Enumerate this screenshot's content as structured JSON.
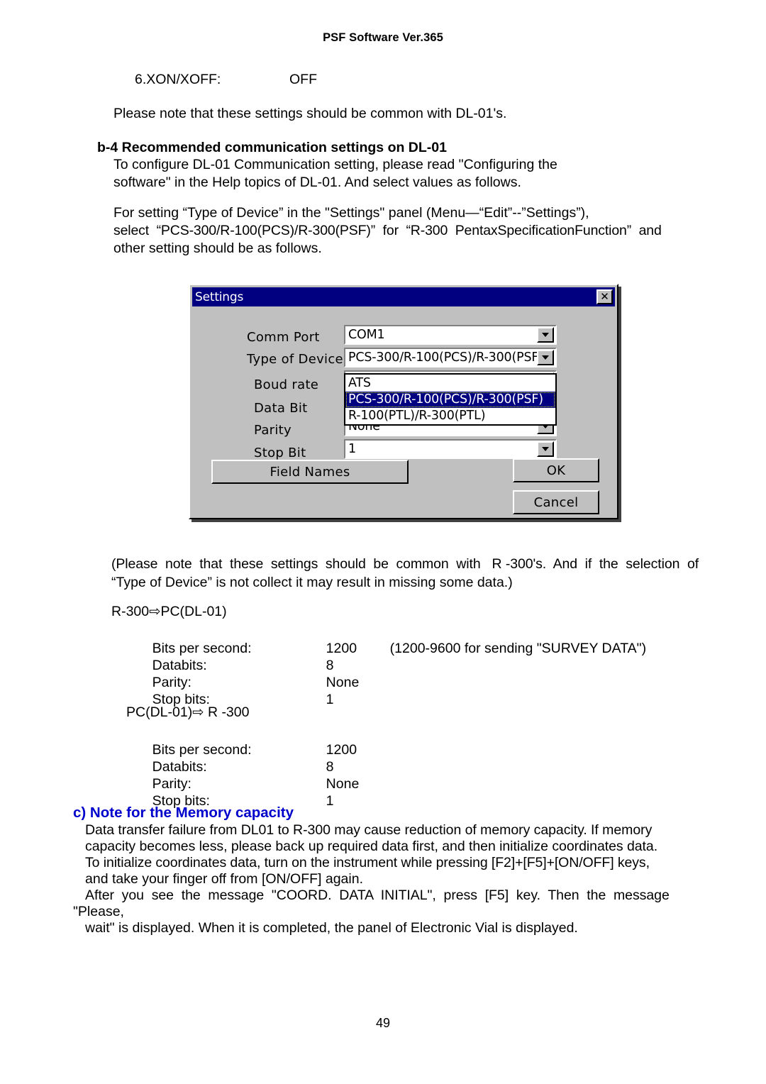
{
  "header": {
    "title": "PSF Software Ver.365"
  },
  "body": {
    "xon_label": "6.XON/XOFF:",
    "xon_value": "OFF",
    "note_common": "Please note that these settings should be common with DL-01's.",
    "b4_heading": "b-4 Recommended communication settings on DL-01",
    "b4_para1_line1": "To configure DL-01 Communication setting, please read \"Configuring the",
    "b4_para1_line2": "software\" in the Help topics of DL-01. And select values as follows.",
    "b4_para2_line1": "For setting “Type of Device” in the \"Settings\" panel (Menu—“Edit”--”Settings”),",
    "b4_para2_line2": "select  “PCS-300/R-100(PCS)/R-300(PSF)”  for  “R-300  PentaxSpecificationFunction”  and",
    "b4_para2_line3": "other setting should be as follows.",
    "after_dialog_line1": "(Please  note  that  these  settings  should  be  common  with   R -300's.  And  if  the  selection  of",
    "after_dialog_line2": "“Type of Device” is not collect it may result in missing some data.)"
  },
  "settings_blocks": [
    {
      "title": "R-300⇨PC(DL-01)",
      "rows": [
        {
          "key": "Bits per second:",
          "value": "1200",
          "note": "(1200-9600 for sending \"SURVEY DATA\")"
        },
        {
          "key": "Databits:",
          "value": "8",
          "note": ""
        },
        {
          "key": "Parity:",
          "value": "None",
          "note": ""
        },
        {
          "key": "Stop bits:",
          "value": "1",
          "note": ""
        }
      ]
    },
    {
      "title": "PC(DL-01)⇨ R -300",
      "rows": [
        {
          "key": "Bits per second:",
          "value": "1200",
          "note": ""
        },
        {
          "key": "Databits:",
          "value": "8",
          "note": ""
        },
        {
          "key": "Parity:",
          "value": "None",
          "note": ""
        },
        {
          "key": "Stop bits:",
          "value": "1",
          "note": ""
        }
      ]
    }
  ],
  "memory_note": {
    "heading": "c) Note for the Memory capacity",
    "line1": "Data transfer failure from DL01 to R-300 may cause reduction of memory capacity. If memory",
    "line2": "capacity becomes less, please back up required data first, and then initialize coordinates data.",
    "line3": "To initialize coordinates data, turn on the instrument while pressing [F2]+[F5]+[ON/OFF] keys,",
    "line4": "and take your finger off from [ON/OFF] again.",
    "line5": "After  you  see  the  message  \"COORD.  DATA  INITIAL\",  press  [F5]  key.  Then  the  message",
    "line6": "\"Please,",
    "line7": "wait\" is displayed. When it is completed, the panel of Electronic Vial is displayed."
  },
  "dialog": {
    "title": "Settings",
    "close_glyph": "✕",
    "fields": [
      {
        "label": "Comm Port",
        "value": "COM1"
      },
      {
        "label": "Type of Device",
        "value": "PCS-300/R-100(PCS)/R-300(PSF)"
      },
      {
        "label": "Boud rate",
        "value": ""
      },
      {
        "label": "Data Bit",
        "value": ""
      },
      {
        "label": "Parity",
        "value": "None"
      },
      {
        "label": "Stop Bit",
        "value": "1"
      }
    ],
    "dropdown_options": [
      "ATS",
      "PCS-300/R-100(PCS)/R-300(PSF)",
      "R-100(PTL)/R-300(PTL)"
    ],
    "dropdown_selected_index": 1,
    "buttons": {
      "field_names": "Field Names",
      "ok": "OK",
      "cancel": "Cancel"
    },
    "colors": {
      "titlebar": "#000080",
      "face": "#c0c0c0",
      "highlight": "#000080"
    }
  },
  "footer": {
    "page_number": "49"
  }
}
